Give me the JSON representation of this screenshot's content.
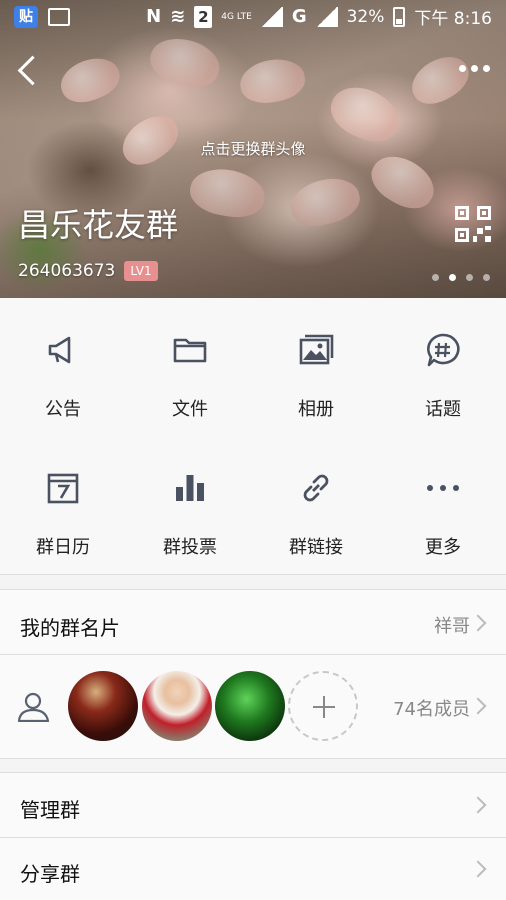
{
  "status_bar": {
    "app_badge": "贴",
    "network_glyph": "N",
    "sim_number": "2",
    "network_type": "4G LTE",
    "carrier_glyph": "G",
    "battery": "32%",
    "time": "下午 8:16"
  },
  "header": {
    "change_avatar_hint": "点击更换群头像",
    "group_name": "昌乐花友群",
    "group_id": "264063673",
    "level": "LV1",
    "pager_count": 4,
    "pager_active": 1
  },
  "actions": [
    {
      "label": "公告",
      "icon": "megaphone-icon"
    },
    {
      "label": "文件",
      "icon": "folder-icon"
    },
    {
      "label": "相册",
      "icon": "album-icon"
    },
    {
      "label": "话题",
      "icon": "topic-icon"
    },
    {
      "label": "群日历",
      "icon": "calendar-icon"
    },
    {
      "label": "群投票",
      "icon": "vote-icon"
    },
    {
      "label": "群链接",
      "icon": "link-icon"
    },
    {
      "label": "更多",
      "icon": "more-icon"
    }
  ],
  "my_card": {
    "title": "我的群名片",
    "value": "祥哥"
  },
  "members": {
    "count_label": "74名成员"
  },
  "manage": {
    "title": "管理群"
  },
  "share": {
    "title": "分享群"
  },
  "colors": {
    "icon": "#4a5262",
    "text": "#222222",
    "muted": "#888888",
    "badge": "#e88f8f"
  }
}
